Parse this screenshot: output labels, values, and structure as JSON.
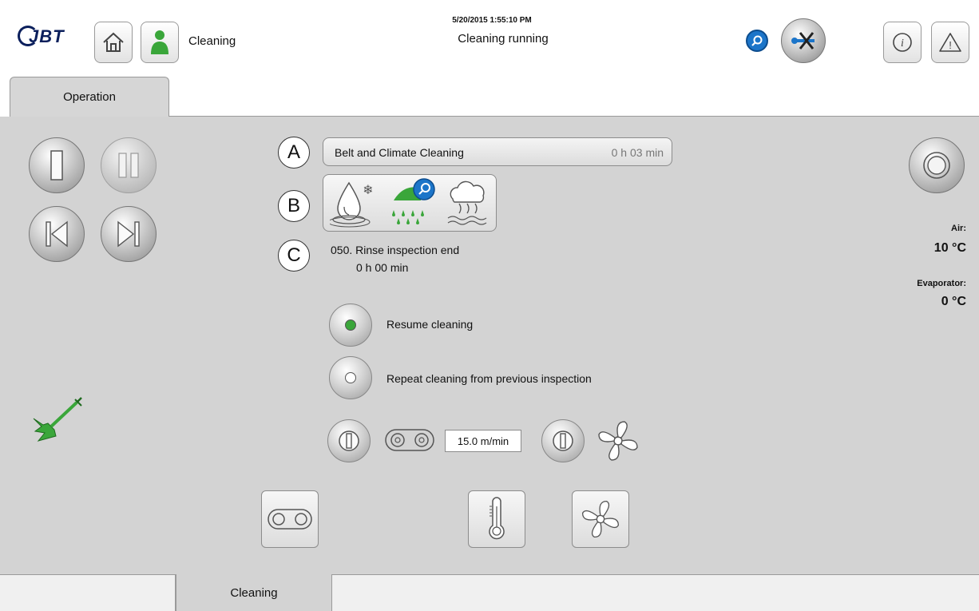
{
  "header": {
    "logo_text": "JBT",
    "user_label": "Cleaning",
    "timestamp": "5/20/2015 1:55:10 PM",
    "status": "Cleaning running"
  },
  "tabs": {
    "operation": "Operation"
  },
  "program": {
    "marker_a": "A",
    "marker_b": "B",
    "marker_c": "C",
    "name": "Belt and Climate Cleaning",
    "remaining": "0 h 03 min",
    "step": "050. Rinse inspection end",
    "step_time": "0 h 00 min"
  },
  "options": [
    {
      "label": "Resume cleaning",
      "selected": true
    },
    {
      "label": "Repeat cleaning from previous inspection",
      "selected": false
    }
  ],
  "drives": {
    "belt_speed": "15.0 m/min"
  },
  "readings": {
    "air_label": "Air:",
    "air_value": "10 °C",
    "evap_label": "Evaporator:",
    "evap_value": "0 °C"
  },
  "bottom": {
    "cleaning_tab": "Cleaning"
  },
  "colors": {
    "accent_green": "#3aa63a",
    "accent_blue": "#1c75c9",
    "panel": "#d3d3d3"
  }
}
